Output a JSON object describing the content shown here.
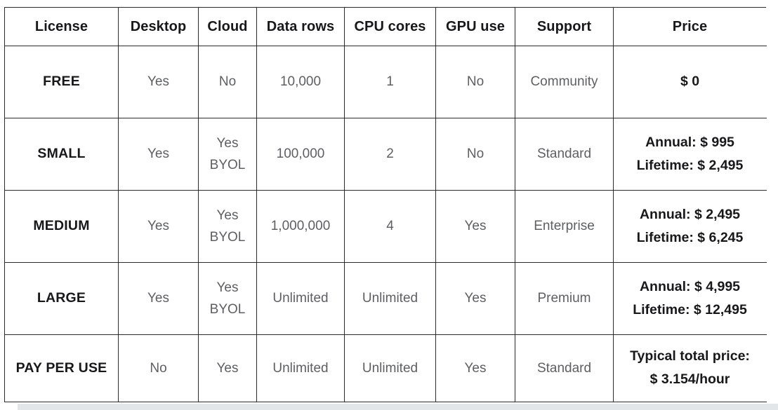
{
  "table": {
    "columns": [
      {
        "key": "license",
        "label": "License"
      },
      {
        "key": "desktop",
        "label": "Desktop"
      },
      {
        "key": "cloud",
        "label": "Cloud"
      },
      {
        "key": "datarows",
        "label": "Data rows"
      },
      {
        "key": "cpu",
        "label": "CPU cores"
      },
      {
        "key": "gpu",
        "label": "GPU use"
      },
      {
        "key": "support",
        "label": "Support"
      },
      {
        "key": "price",
        "label": "Price"
      }
    ],
    "rows": [
      {
        "license": "FREE",
        "desktop": "Yes",
        "cloud_line1": "No",
        "cloud_line2": "",
        "datarows": "10,000",
        "cpu": "1",
        "gpu": "No",
        "support": "Community",
        "price_line1": "$ 0",
        "price_line2": ""
      },
      {
        "license": "SMALL",
        "desktop": "Yes",
        "cloud_line1": "Yes",
        "cloud_line2": "BYOL",
        "datarows": "100,000",
        "cpu": "2",
        "gpu": "No",
        "support": "Standard",
        "price_line1": "Annual: $ 995",
        "price_line2": "Lifetime: $ 2,495"
      },
      {
        "license": "MEDIUM",
        "desktop": "Yes",
        "cloud_line1": "Yes",
        "cloud_line2": "BYOL",
        "datarows": "1,000,000",
        "cpu": "4",
        "gpu": "Yes",
        "support": "Enterprise",
        "price_line1": "Annual: $ 2,495",
        "price_line2": "Lifetime: $ 6,245"
      },
      {
        "license": "LARGE",
        "desktop": "Yes",
        "cloud_line1": "Yes",
        "cloud_line2": "BYOL",
        "datarows": "Unlimited",
        "cpu": "Unlimited",
        "gpu": "Yes",
        "support": "Premium",
        "price_line1": "Annual: $ 4,995",
        "price_line2": "Lifetime: $ 12,495"
      },
      {
        "license": "PAY PER USE",
        "desktop": "No",
        "cloud_line1": "Yes",
        "cloud_line2": "",
        "datarows": "Unlimited",
        "cpu": "Unlimited",
        "gpu": "Yes",
        "support": "Standard",
        "price_line1": "Typical total price:",
        "price_line2": "$ 3.154/hour"
      }
    ]
  },
  "colors": {
    "border": "#2b2b2b",
    "header_text": "#17181a",
    "cell_text": "#5c5f63",
    "emphasis_text": "#17181a",
    "background": "#ffffff",
    "scrollbar_track": "#eceff1"
  }
}
